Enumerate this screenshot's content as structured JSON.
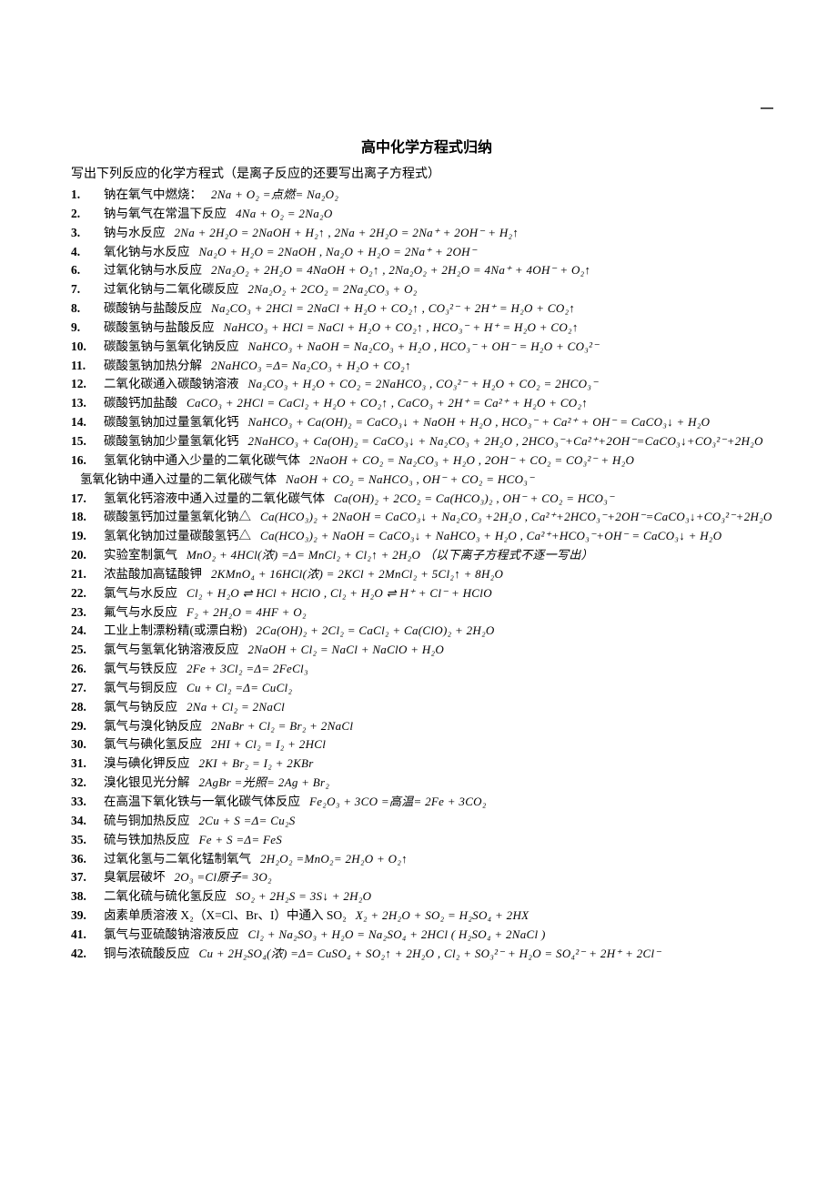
{
  "title": "高中化学方程式归纳",
  "intro": "写出下列反应的化学方程式（是离子反应的还要写出离子方程式）",
  "rows": [
    {
      "n": "1.",
      "p": "钠在氧气中燃烧：",
      "h": "2Na + O₂ =点燃= Na₂O₂"
    },
    {
      "n": "2.",
      "p": "钠与氧气在常温下反应",
      "h": "4Na + O₂ = 2Na₂O"
    },
    {
      "n": "3.",
      "p": "钠与水反应",
      "h": "2Na + 2H₂O = 2NaOH + H₂↑ ,  2Na + 2H₂O = 2Na⁺ + 2OH⁻ + H₂↑"
    },
    {
      "n": "4.",
      "p": "氧化钠与水反应",
      "h": "Na₂O + H₂O = 2NaOH   ,   Na₂O + H₂O = 2Na⁺ + 2OH⁻"
    },
    {
      "n": "6.",
      "p": "过氧化钠与水反应",
      "h": "2Na₂O₂ + 2H₂O = 4NaOH + O₂↑ ,  2Na₂O₂ + 2H₂O = 4Na⁺ + 4OH⁻ + O₂↑"
    },
    {
      "n": "7.",
      "p": "过氧化钠与二氧化碳反应",
      "h": "2Na₂O₂ + 2CO₂ = 2Na₂CO₃ + O₂"
    },
    {
      "n": "8.",
      "p": "碳酸钠与盐酸反应",
      "h": "Na₂CO₃ + 2HCl = 2NaCl + H₂O + CO₂↑ ,  CO₃²⁻ + 2H⁺ = H₂O + CO₂↑"
    },
    {
      "n": "9.",
      "p": "碳酸氢钠与盐酸反应",
      "h": "NaHCO₃ + HCl = NaCl + H₂O + CO₂↑ ,  HCO₃⁻ + H⁺ = H₂O + CO₂↑"
    },
    {
      "n": "10.",
      "p": "碳酸氢钠与氢氧化钠反应",
      "h": "NaHCO₃ + NaOH = Na₂CO₃ + H₂O ,  HCO₃⁻ + OH⁻ = H₂O + CO₃²⁻"
    },
    {
      "n": "11.",
      "p": "碳酸氢钠加热分解",
      "h": "2NaHCO₃ =Δ= Na₂CO₃ + H₂O + CO₂↑"
    },
    {
      "n": "12.",
      "p": "二氧化碳通入碳酸钠溶液",
      "h": "Na₂CO₃ + H₂O + CO₂ = 2NaHCO₃ ,  CO₃²⁻ + H₂O + CO₂ = 2HCO₃⁻"
    },
    {
      "n": "13.",
      "p": "碳酸钙加盐酸",
      "h": "CaCO₃ + 2HCl = CaCl₂ + H₂O + CO₂↑ ,  CaCO₃ + 2H⁺ = Ca²⁺ + H₂O + CO₂↑"
    },
    {
      "n": "14.",
      "p": "碳酸氢钠加过量氢氧化钙",
      "h": "NaHCO₃ + Ca(OH)₂ = CaCO₃↓ + NaOH + H₂O , HCO₃⁻ + Ca²⁺ + OH⁻ = CaCO₃↓ + H₂O"
    },
    {
      "n": "15.",
      "p": "碳酸氢钠加少量氢氧化钙",
      "h": "2NaHCO₃ + Ca(OH)₂ = CaCO₃↓ + Na₂CO₃ + 2H₂O , 2HCO₃⁻+Ca²⁺+2OH⁻=CaCO₃↓+CO₃²⁻+2H₂O"
    },
    {
      "n": "16.",
      "p": "氢氧化钠中通入少量的二氧化碳气体",
      "h": "2NaOH + CO₂ = Na₂CO₃ + H₂O ,  2OH⁻ + CO₂ = CO₃²⁻ + H₂O"
    },
    {
      "n": "",
      "p": "氢氧化钠中通入过量的二氧化碳气体",
      "h": "NaOH + CO₂ = NaHCO₃  ,  OH⁻ + CO₂ = HCO₃⁻",
      "noindent": true
    },
    {
      "n": "17.",
      "p": "氢氧化钙溶液中通入过量的二氧化碳气体",
      "h": "Ca(OH)₂ + 2CO₂  =  Ca(HCO₃)₂ ,   OH⁻ + CO₂ = HCO₃⁻"
    },
    {
      "n": "18.",
      "p": "碳酸氢钙加过量氢氧化钠△",
      "h": "Ca(HCO₃)₂ + 2NaOH = CaCO₃↓ + Na₂CO₃ +2H₂O , Ca²⁺+2HCO₃⁻+2OH⁻=CaCO₃↓+CO₃²⁻+2H₂O"
    },
    {
      "n": "19.",
      "p": "氢氧化钠加过量碳酸氢钙△",
      "h": "Ca(HCO₃)₂ + NaOH = CaCO₃↓ + NaHCO₃ + H₂O , Ca²⁺+HCO₃⁻+OH⁻ = CaCO₃↓ + H₂O"
    },
    {
      "n": "20.",
      "p": "实验室制氯气",
      "h": "MnO₂ + 4HCl(浓) =Δ= MnCl₂ + Cl₂↑ + 2H₂O    （以下离子方程式不逐一写出）"
    },
    {
      "n": "21.",
      "p": "浓盐酸加高锰酸钾",
      "h": "2KMnO₄ + 16HCl(浓) = 2KCl + 2MnCl₂ + 5Cl₂↑ + 8H₂O"
    },
    {
      "n": "22.",
      "p": "氯气与水反应",
      "h": "Cl₂ + H₂O ⇌ HCl + HClO ,   Cl₂ + H₂O ⇌ H⁺ + Cl⁻ + HClO"
    },
    {
      "n": "23.",
      "p": "氟气与水反应",
      "h": "F₂ + 2H₂O = 4HF + O₂"
    },
    {
      "n": "24.",
      "p": "工业上制漂粉精(或漂白粉)",
      "h": "2Ca(OH)₂ + 2Cl₂ = CaCl₂ + Ca(ClO)₂ + 2H₂O"
    },
    {
      "n": "25.",
      "p": "氯气与氢氧化钠溶液反应",
      "h": "2NaOH + Cl₂ = NaCl + NaClO + H₂O"
    },
    {
      "n": "26.",
      "p": "氯气与铁反应",
      "h": "2Fe + 3Cl₂ =Δ= 2FeCl₃"
    },
    {
      "n": "27.",
      "p": "氯气与铜反应",
      "h": "Cu + Cl₂ =Δ= CuCl₂"
    },
    {
      "n": "28.",
      "p": "氯气与钠反应",
      "h": "2Na + Cl₂ = 2NaCl"
    },
    {
      "n": "29.",
      "p": "氯气与溴化钠反应",
      "h": "2NaBr + Cl₂ = Br₂ + 2NaCl"
    },
    {
      "n": "30.",
      "p": "氯气与碘化氢反应",
      "h": "2HI + Cl₂ = I₂ + 2HCl"
    },
    {
      "n": "31.",
      "p": "溴与碘化钾反应",
      "h": "2KI + Br₂ = I₂ + 2KBr"
    },
    {
      "n": "32.",
      "p": "溴化银见光分解",
      "h": "2AgBr =光照= 2Ag + Br₂"
    },
    {
      "n": "33.",
      "p": "在高温下氧化铁与一氧化碳气体反应",
      "h": "Fe₂O₃ + 3CO =高温= 2Fe + 3CO₂"
    },
    {
      "n": "34.",
      "p": "硫与铜加热反应",
      "h": "2Cu + S =Δ= Cu₂S"
    },
    {
      "n": "35.",
      "p": "硫与铁加热反应",
      "h": "Fe + S =Δ= FeS"
    },
    {
      "n": "36.",
      "p": "过氧化氢与二氧化锰制氧气",
      "h": "2H₂O₂ =MnO₂= 2H₂O + O₂↑"
    },
    {
      "n": "37.",
      "p": "臭氧层破坏",
      "h": "2O₃ =Cl原子= 3O₂"
    },
    {
      "n": "38.",
      "p": "二氧化硫与硫化氢反应",
      "h": "SO₂ + 2H₂S = 3S↓ + 2H₂O"
    },
    {
      "n": "39.",
      "p": "卤素单质溶液 X₂（X=Cl、Br、I）中通入 SO₂",
      "h": "X₂ + 2H₂O + SO₂ = H₂SO₄ + 2HX"
    },
    {
      "n": "41.",
      "p": "氯气与亚硫酸钠溶液反应",
      "h": "Cl₂ + Na₂SO₃ + H₂O = Na₂SO₄ + 2HCl  ( H₂SO₄ + 2NaCl )"
    },
    {
      "n": "42.",
      "p": "铜与浓硫酸反应",
      "h": "Cu + 2H₂SO₄(浓) =Δ= CuSO₄ + SO₂↑ + 2H₂O , Cl₂ + SO₃²⁻ + H₂O = SO₄²⁻ + 2H⁺ + 2Cl⁻"
    }
  ]
}
